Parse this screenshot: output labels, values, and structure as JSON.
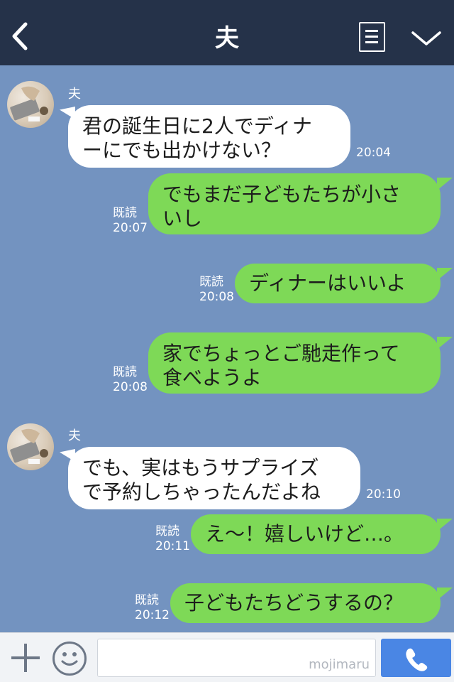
{
  "header": {
    "title": "夫",
    "back_icon": "chevron-left-icon",
    "note_icon": "notes-icon",
    "menu_icon": "chevron-down-icon",
    "bg_color": "#253249"
  },
  "chat": {
    "bg_color": "#7393c0",
    "incoming_color": "#ffffff",
    "outgoing_color": "#7ed957",
    "messages": [
      {
        "side": "in",
        "sender": "夫",
        "lines": [
          "君の誕生日に2人でディナ",
          "ーにでも出かけない？"
        ],
        "time": "20:04"
      },
      {
        "side": "out",
        "read": "既読",
        "lines": [
          "でもまだ子どもたちが小さ",
          "いし"
        ],
        "time": "20:07"
      },
      {
        "side": "out",
        "read": "既読",
        "lines": [
          "ディナーはいいよ"
        ],
        "time": "20:08"
      },
      {
        "side": "out",
        "read": "既読",
        "lines": [
          "家でちょっとご馳走作って",
          "食べようよ"
        ],
        "time": "20:08"
      },
      {
        "side": "in",
        "sender": "夫",
        "lines": [
          "でも、実はもうサプライズ",
          "で予約しちゃったんだよね"
        ],
        "time": "20:10"
      },
      {
        "side": "out",
        "read": "既読",
        "lines": [
          "え～！嬉しいけど…。"
        ],
        "time": "20:11"
      },
      {
        "side": "out",
        "read": "既読",
        "lines": [
          "子どもたちどうするの？"
        ],
        "time": "20:12"
      }
    ]
  },
  "footer": {
    "plus_icon": "plus-icon",
    "emoji_icon": "smiley-icon",
    "input_watermark": "mojimaru",
    "send_icon": "phone-icon",
    "send_color": "#4a86e4"
  }
}
